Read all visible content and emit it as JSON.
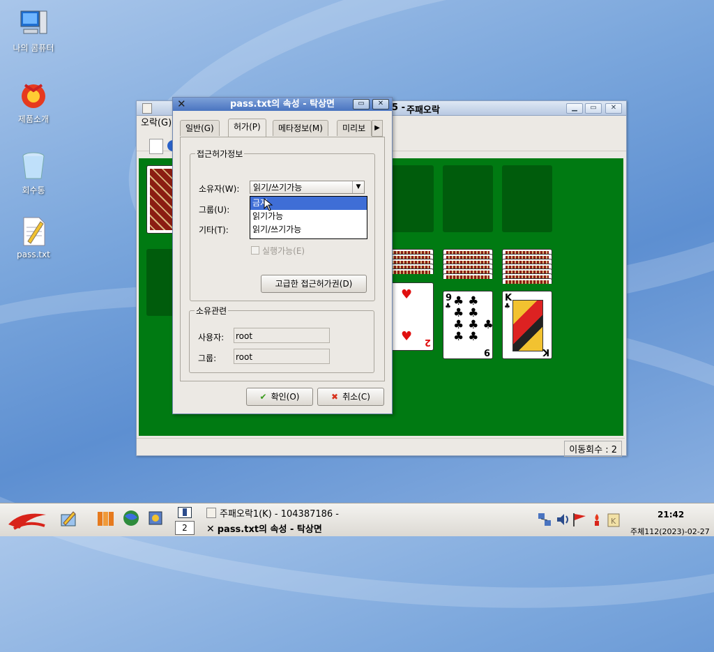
{
  "desktop": {
    "icons": [
      {
        "label": "나의 콤퓨터",
        "icon": "computer-icon"
      },
      {
        "label": "제품소개",
        "icon": "product-icon"
      },
      {
        "label": "회수통",
        "icon": "trash-icon"
      },
      {
        "label": "pass.txt",
        "icon": "text-file-icon"
      }
    ]
  },
  "solitaire": {
    "title": "주패오락",
    "title_prefix": "5 - ",
    "menu": [
      "오락(G)"
    ],
    "status": "이동회수 : 2",
    "visible_cards": [
      {
        "rank": "2",
        "suit": "hearts"
      },
      {
        "rank": "9",
        "suit": "clubs"
      },
      {
        "rank": "K",
        "suit": "clubs"
      }
    ],
    "colors": {
      "felt": "#007a12",
      "slot": "#005c0c"
    }
  },
  "dialog": {
    "title": "pass.txt의 속성 - 탁상면",
    "tabs": [
      "일반(G)",
      "허가(P)",
      "메타정보(M)",
      "미리보"
    ],
    "active_tab": "허가(P)",
    "access_group_label": "접근허가정보",
    "owner_label": "소유자(W):",
    "group_label": "그룹(U):",
    "other_label": "기타(T):",
    "owner_value": "읽기/쓰기가능",
    "dropdown_options": [
      "금지",
      "읽기가능",
      "읽기/쓰기가능"
    ],
    "dropdown_selected": "금지",
    "exec_label": "실행가능(E)",
    "advanced_button": "고급한 접근허가권(D)",
    "ownership_group_label": "소유관련",
    "user_label": "사용자:",
    "user_value": "root",
    "group_field_label": "그룹:",
    "group_value": "root",
    "ok_button": "확인(O)",
    "cancel_button": "취소(C)"
  },
  "taskbar": {
    "workspace_number": "2",
    "tasks": [
      {
        "label": "주패오락1(K) - 104387186 -"
      },
      {
        "label": "pass.txt의 속성 - 탁상면"
      }
    ],
    "clock_time": "21:42",
    "clock_date": "주체112(2023)-02-27",
    "accent": "#3f6ed6"
  }
}
